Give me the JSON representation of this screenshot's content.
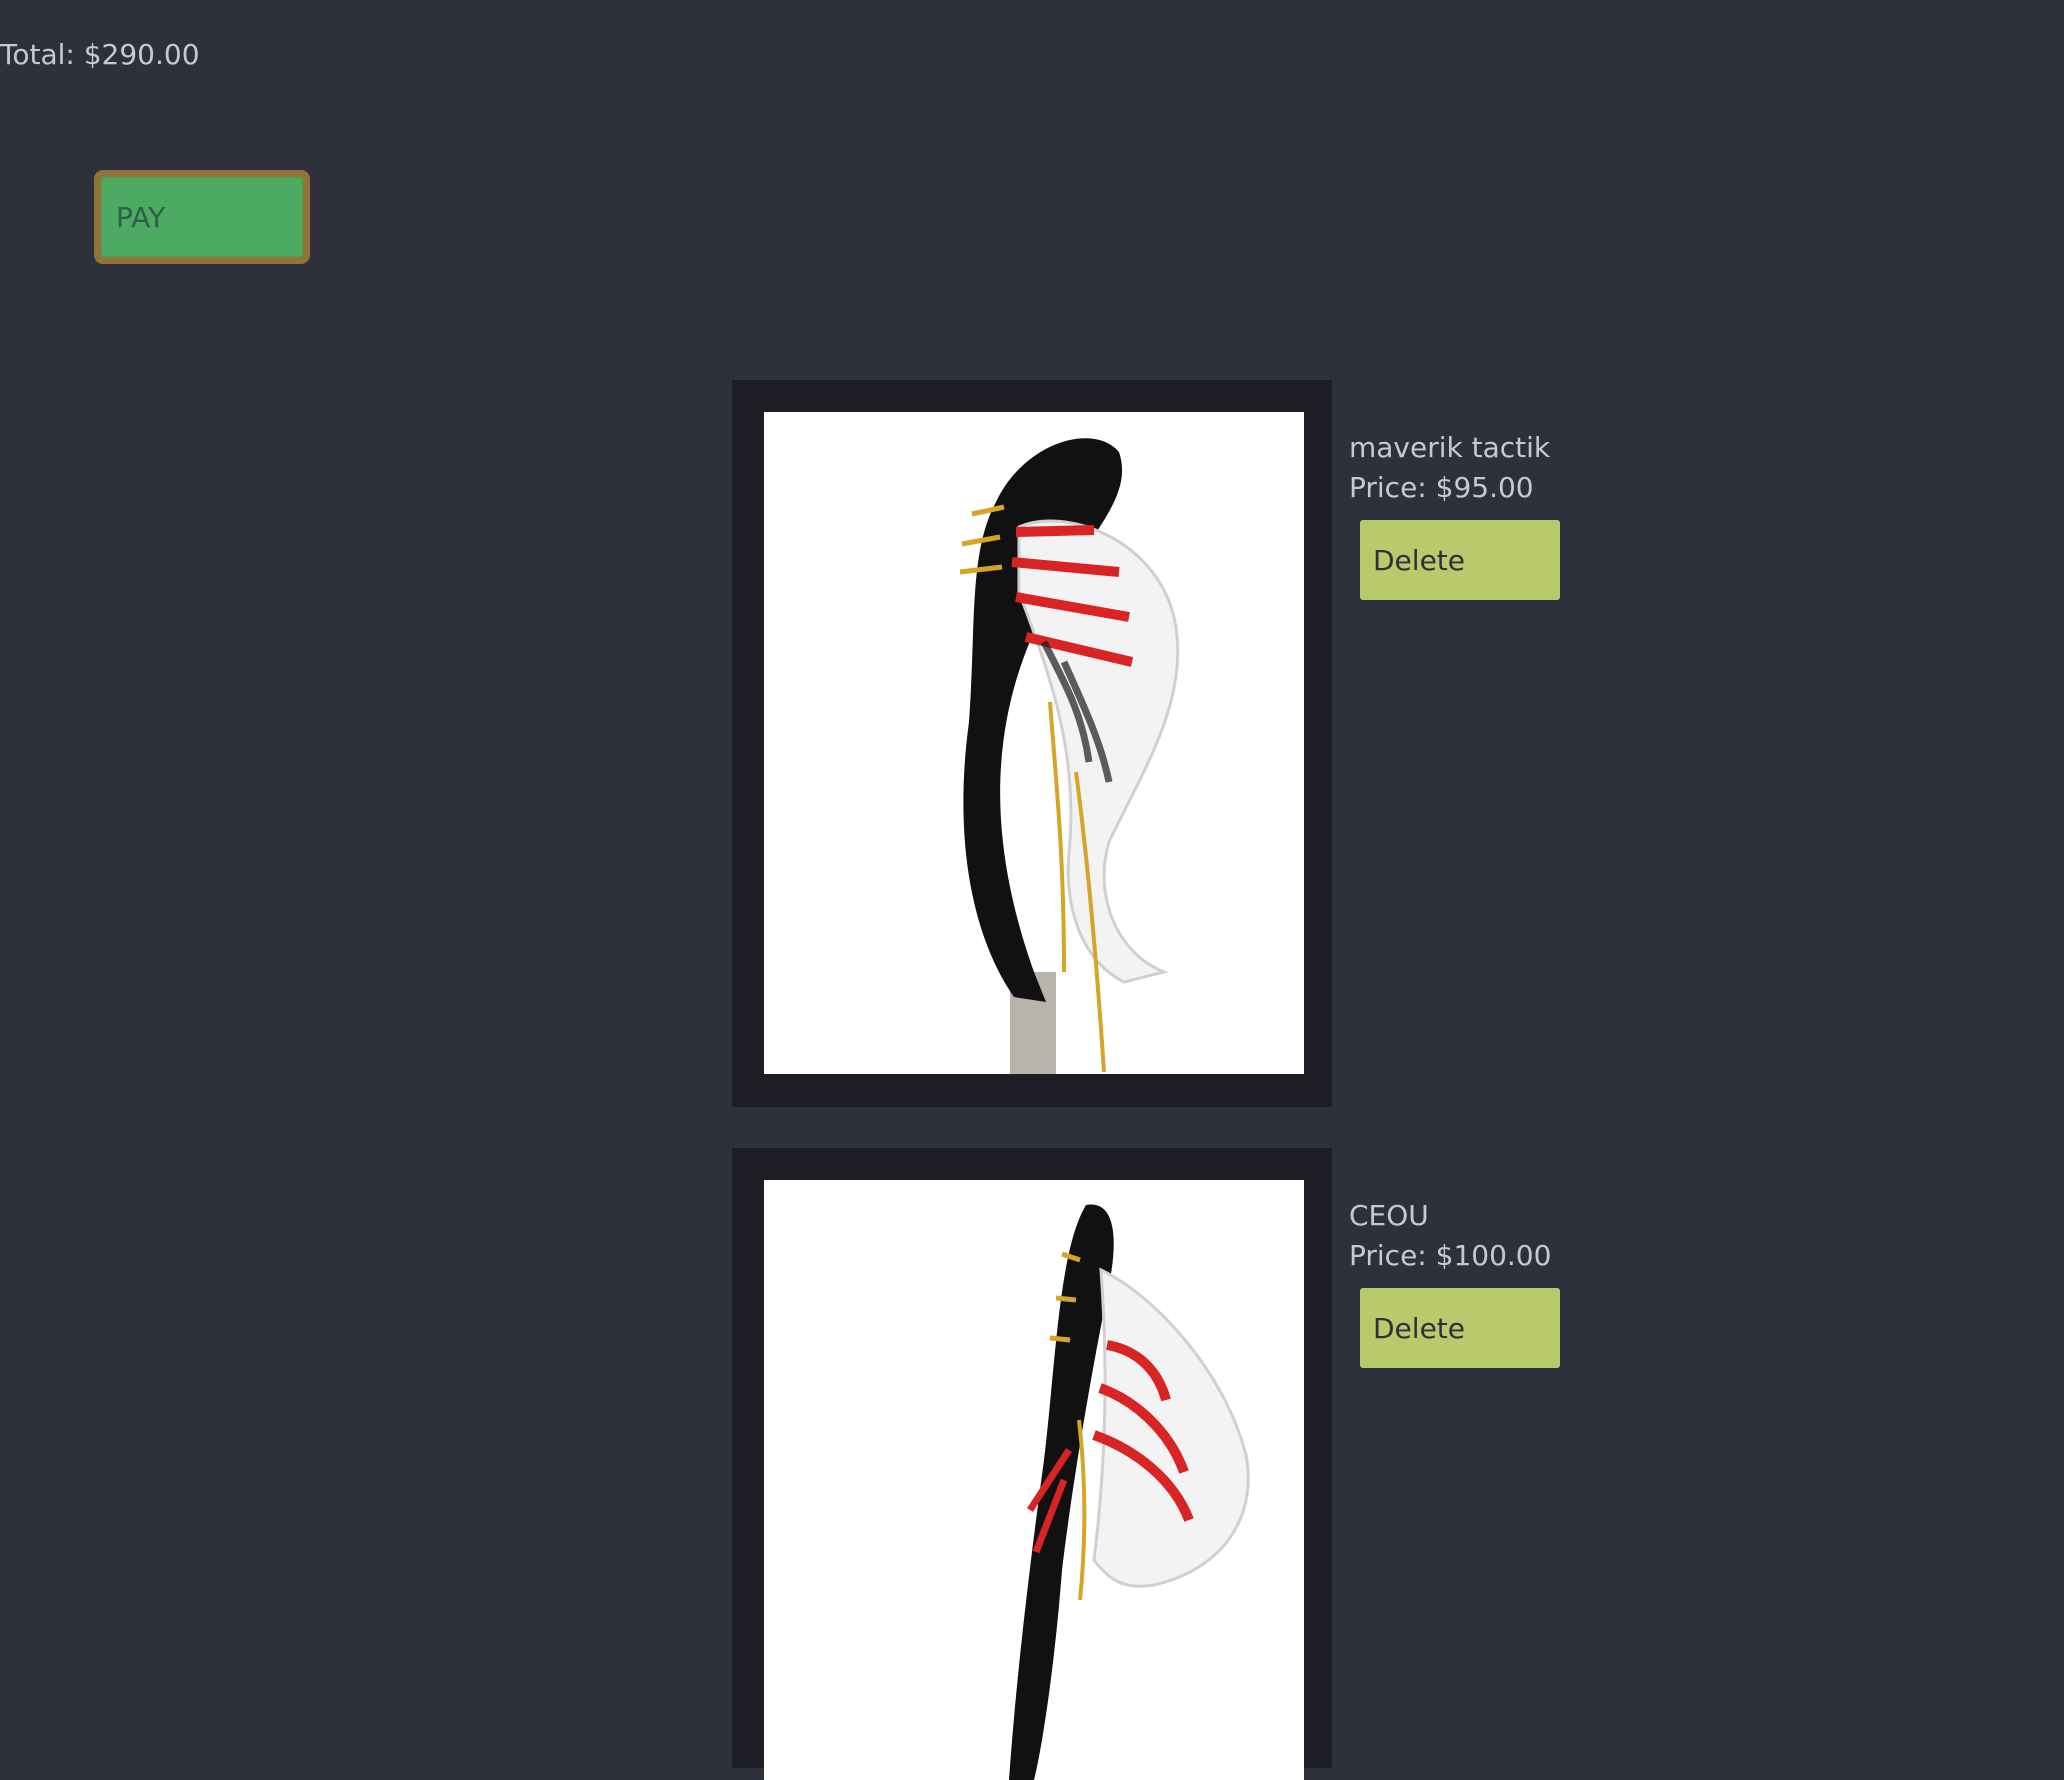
{
  "cart": {
    "total_text": "Total: $290.00",
    "pay_label": "PAY"
  },
  "items": [
    {
      "name": "maverik tactik",
      "price_text": "Price: $95.00",
      "delete_label": "Delete",
      "image_icon": "lacrosse-head-image"
    },
    {
      "name": "CEOU",
      "price_text": "Price: $100.00",
      "delete_label": "Delete",
      "image_icon": "lacrosse-head-image"
    }
  ],
  "colors": {
    "background": "#2e303c",
    "card": "#1c1d25",
    "pay_button": "#4caa62",
    "pay_border": "#93713a",
    "delete_button": "#b9ca6c",
    "text": "#c7c9d1"
  }
}
